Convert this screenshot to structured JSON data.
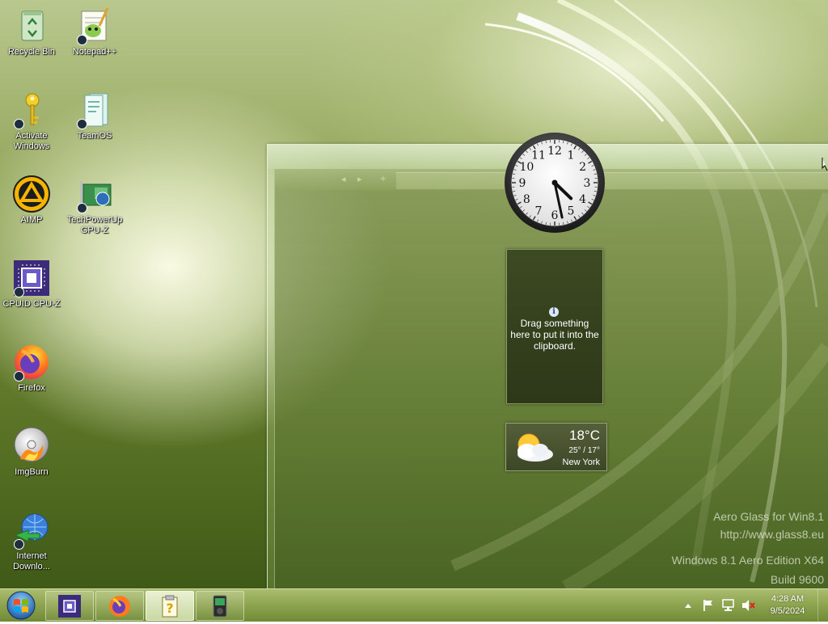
{
  "desktop": {
    "icons": [
      {
        "label": "Recycle Bin",
        "icon": "recycle-bin-icon"
      },
      {
        "label": "Notepad++",
        "icon": "notepad-plus-plus-icon"
      },
      {
        "label": "Activate Windows",
        "icon": "key-icon"
      },
      {
        "label": "TeamOS",
        "icon": "teamos-icon"
      },
      {
        "label": "AIMP",
        "icon": "aimp-icon"
      },
      {
        "label": "TechPowerUp GPU-Z",
        "icon": "gpu-z-icon"
      },
      {
        "label": "CPUID CPU-Z",
        "icon": "cpu-z-icon"
      },
      {
        "label": "Firefox",
        "icon": "firefox-icon"
      },
      {
        "label": "ImgBurn",
        "icon": "imgburn-icon"
      },
      {
        "label": "Internet Downlo...",
        "icon": "internet-download-manager-icon"
      }
    ]
  },
  "glass_window": {
    "nav_back": "◂",
    "nav_forward": "▸",
    "nav_add": "+"
  },
  "gadgets": {
    "clock": {
      "time": "4:28",
      "numerals": [
        "12",
        "1",
        "2",
        "3",
        "4",
        "5",
        "6",
        "7",
        "8",
        "9",
        "10",
        "11"
      ]
    },
    "clipboard": {
      "info_glyph": "i",
      "message": "Drag something here to put it into the clipboard."
    },
    "weather": {
      "temperature": "18°C",
      "range": "25° / 17°",
      "city": "New York",
      "icon": "partly-sunny-icon"
    }
  },
  "watermark": {
    "line1": "Aero Glass for Win8.1",
    "line2": "http://www.glass8.eu",
    "line3": "Windows 8.1 Aero Edition X64",
    "line4": "Build 9600"
  },
  "taskbar": {
    "start_icon": "windows-start-orb-icon",
    "pinned": [
      {
        "icon": "cpu-z-icon",
        "active": false
      },
      {
        "icon": "firefox-icon",
        "active": false
      },
      {
        "icon": "help-file-icon",
        "active": true
      },
      {
        "icon": "media-player-icon",
        "active": false
      }
    ],
    "tray": {
      "time": "4:28 AM",
      "date": "9/5/2024",
      "icons": [
        "show-hidden-icons-icon",
        "action-center-flag-icon",
        "network-icon",
        "volume-muted-icon"
      ]
    }
  },
  "colors": {
    "wallpaper_light": "#e6eec8",
    "wallpaper_dark": "#3f5a17",
    "taskbar": "#8da34e"
  }
}
